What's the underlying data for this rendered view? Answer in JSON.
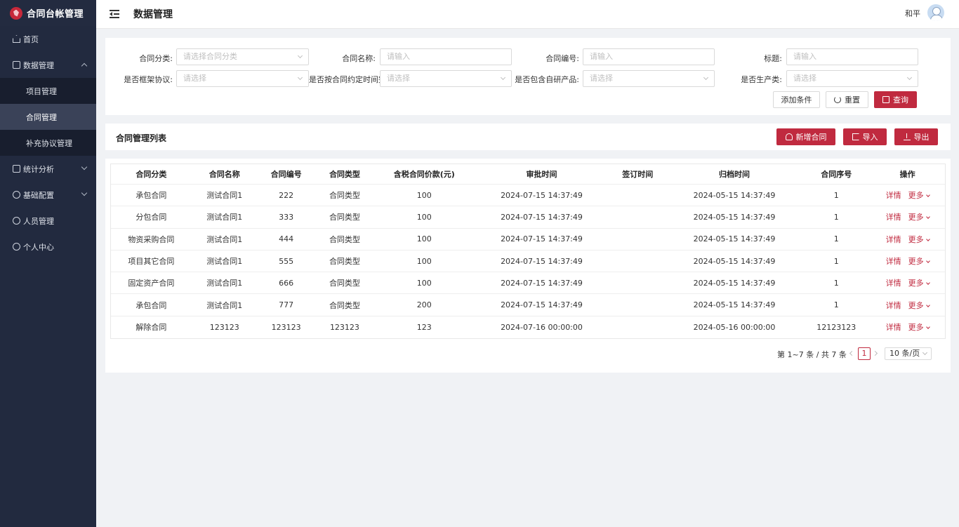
{
  "app": {
    "title": "合同台帐管理"
  },
  "sidebar": {
    "items": [
      {
        "label": "首页"
      },
      {
        "label": "数据管理"
      },
      {
        "label": "统计分析"
      },
      {
        "label": "基础配置"
      },
      {
        "label": "人员管理"
      },
      {
        "label": "个人中心"
      }
    ],
    "sub": [
      {
        "label": "项目管理"
      },
      {
        "label": "合同管理"
      },
      {
        "label": "补充协议管理"
      }
    ]
  },
  "header": {
    "title": "数据管理",
    "user": "和平"
  },
  "filter": {
    "labels": [
      "合同分类:",
      "合同名称:",
      "合同编号:",
      "标题:",
      "是否框架协议:",
      "是否按合同约定时间完",
      "是否包含自研产品:",
      "是否生产类:"
    ],
    "placeholders": [
      "请选择合同分类",
      "请输入",
      "请输入",
      "请输入",
      "请选择",
      "请选择",
      "请选择",
      "请选择"
    ],
    "add_condition": "添加条件",
    "reset": "重置",
    "search": "查询"
  },
  "list": {
    "title": "合同管理列表",
    "add": "新增合同",
    "import": "导入",
    "export": "导出"
  },
  "table": {
    "columns": [
      "合同分类",
      "合同名称",
      "合同编号",
      "合同类型",
      "含税合同价款(元)",
      "审批时间",
      "签订时间",
      "归档时间",
      "合同序号",
      "操作"
    ],
    "rows": [
      [
        "承包合同",
        "测试合同1",
        "222",
        "合同类型",
        "100",
        "2024-07-15 14:37:49",
        "",
        "2024-05-15 14:37:49",
        "1"
      ],
      [
        "分包合同",
        "测试合同1",
        "333",
        "合同类型",
        "100",
        "2024-07-15 14:37:49",
        "",
        "2024-05-15 14:37:49",
        "1"
      ],
      [
        "物资采购合同",
        "测试合同1",
        "444",
        "合同类型",
        "100",
        "2024-07-15 14:37:49",
        "",
        "2024-05-15 14:37:49",
        "1"
      ],
      [
        "项目其它合同",
        "测试合同1",
        "555",
        "合同类型",
        "100",
        "2024-07-15 14:37:49",
        "",
        "2024-05-15 14:37:49",
        "1"
      ],
      [
        "固定资产合同",
        "测试合同1",
        "666",
        "合同类型",
        "100",
        "2024-07-15 14:37:49",
        "",
        "2024-05-15 14:37:49",
        "1"
      ],
      [
        "承包合同",
        "测试合同1",
        "777",
        "合同类型",
        "200",
        "2024-07-15 14:37:49",
        "",
        "2024-05-15 14:37:49",
        "1"
      ],
      [
        "解除合同",
        "123123",
        "123123",
        "123123",
        "123",
        "2024-07-16 00:00:00",
        "",
        "2024-05-16 00:00:00",
        "12123123"
      ]
    ],
    "action_detail": "详情",
    "action_more": "更多"
  },
  "pagination": {
    "total_text": "第 1~7 条 / 共 7 条",
    "current_page": "1",
    "page_size": "10 条/页"
  },
  "colors": {
    "primary": "#c02a3f",
    "sidebar": "#222a3f"
  }
}
